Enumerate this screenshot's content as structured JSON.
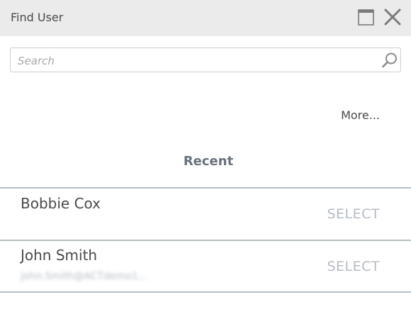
{
  "window": {
    "title": "Find User",
    "maximize_icon": "maximize-icon",
    "close_icon": "close-icon"
  },
  "search": {
    "placeholder": "Search",
    "value": "",
    "icon": "search-icon"
  },
  "more_label": "More...",
  "section_heading": "Recent",
  "users": [
    {
      "name": "Bobbie Cox",
      "subtitle": "",
      "action": "SELECT"
    },
    {
      "name": "John Smith",
      "subtitle": "john.Smith@ACTdemo1...",
      "action": "SELECT"
    }
  ],
  "colors": {
    "titlebar_bg": "#ebebeb",
    "heading": "#6a727c",
    "divider": "#b8c0c4",
    "select_text": "#b6bcc4"
  }
}
